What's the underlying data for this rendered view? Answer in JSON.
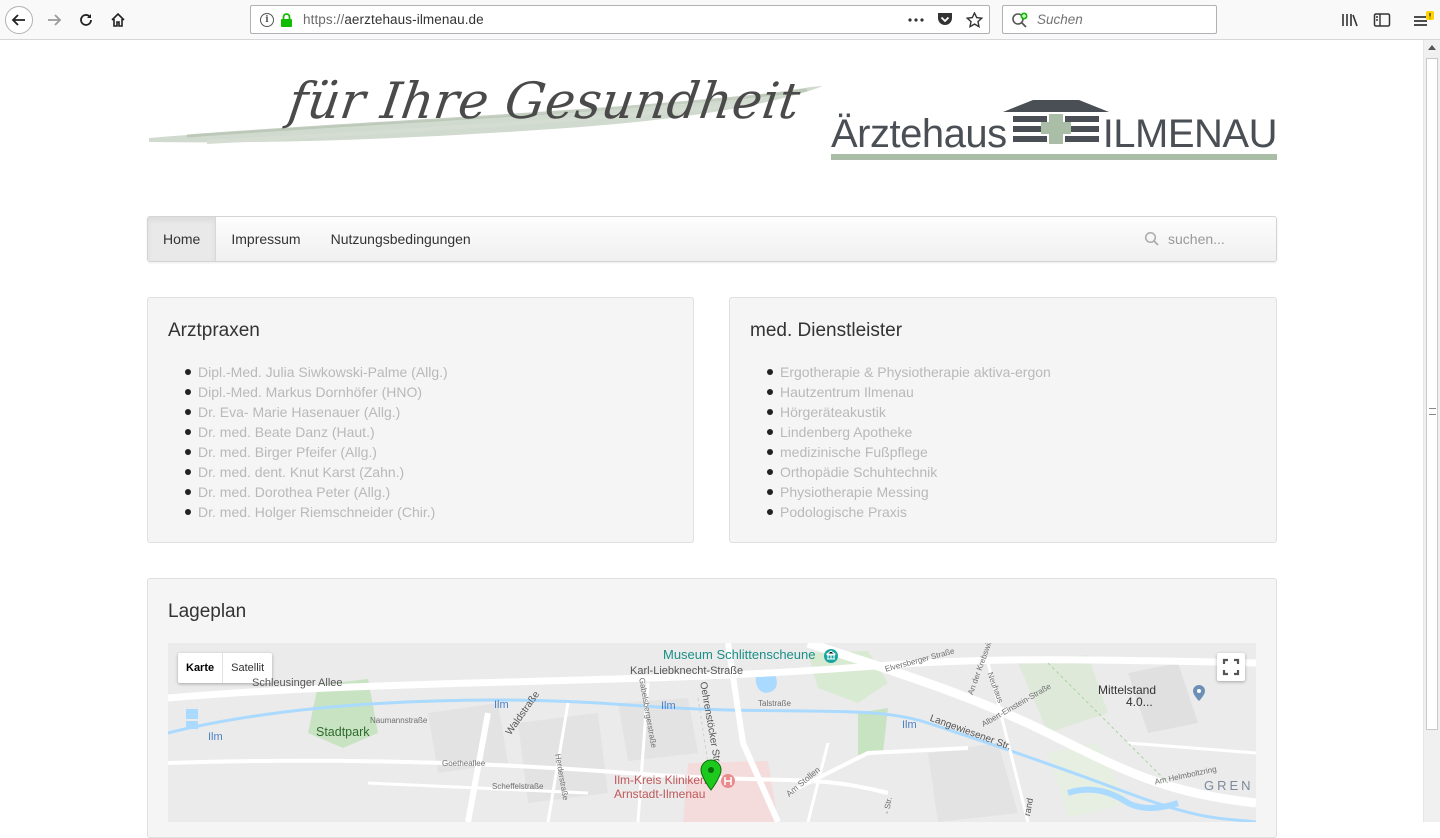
{
  "browser": {
    "url_proto": "https://",
    "url_host": "aerztehaus-ilmenau.de",
    "search_placeholder": "Suchen"
  },
  "header": {
    "tagline": "für Ihre Gesundheit",
    "brand_left": "Ärztehaus",
    "brand_right": "ILMENAU"
  },
  "nav": {
    "items": [
      "Home",
      "Impressum",
      "Nutzungsbedingungen"
    ],
    "search_placeholder": "suchen..."
  },
  "arztpraxen": {
    "title": "Arztpraxen",
    "items": [
      "Dipl.-Med. Julia Siwkowski-Palme (Allg.)",
      "Dipl.-Med. Markus Dornhöfer (HNO)",
      "Dr. Eva- Marie Hasenauer (Allg.)",
      "Dr. med. Beate Danz (Haut.)",
      "Dr. med. Birger Pfeifer (Allg.)",
      "Dr. med. dent. Knut Karst (Zahn.)",
      "Dr. med. Dorothea Peter (Allg.)",
      "Dr. med. Holger Riemschneider (Chir.)"
    ]
  },
  "dienstleister": {
    "title": "med. Dienstleister",
    "items": [
      "Ergotherapie & Physiotherapie aktiva-ergon",
      "Hautzentrum Ilmenau",
      "Hörgeräteakustik",
      "Lindenberg Apotheke",
      "medizinische Fußpflege",
      "Orthopädie Schuhtechnik",
      "Physiotherapie Messing",
      "Podologische Praxis"
    ]
  },
  "lageplan": {
    "title": "Lageplan",
    "map_type": [
      "Karte",
      "Satellit"
    ],
    "labels": {
      "museum": "Museum Schlittenscheune",
      "karl": "Karl-Liebknecht-Straße",
      "schleusinger": "Schleusinger Allee",
      "stadtpark": "Stadtpark",
      "ilm1": "Ilm",
      "ilm2": "Ilm",
      "ilm3": "Ilm",
      "ilm4": "Ilm",
      "naumann": "Naumannstraße",
      "waldstr": "Waldstraße",
      "goethe": "Goetheallee",
      "scheffel": "Scheffelstraße",
      "oehren": "Oehrenstöcker Str.",
      "langewiesener": "Langewiesener Str.",
      "klinik1": "Ilm-Kreis Kliniken",
      "klinik2": "Arnstadt-Ilmenau",
      "mittelstand1": "Mittelstand",
      "mittelstand2": "4.0...",
      "gren": "GREN",
      "helmboltzring": "Am Helmboltzring",
      "stollen": "Am Stollen",
      "einstein": "Albert-Einstein-Straße",
      "krebswiese": "An der Krebswiese",
      "talstr": "Talstraße",
      "neuhaus": "Neuhaus",
      "elvers": "Elversberger Straße",
      "gabelsberger": "Gabelsbergerstraße",
      "herder": "Herderstraße",
      "rand": "rand",
      "str": "- Str."
    }
  }
}
